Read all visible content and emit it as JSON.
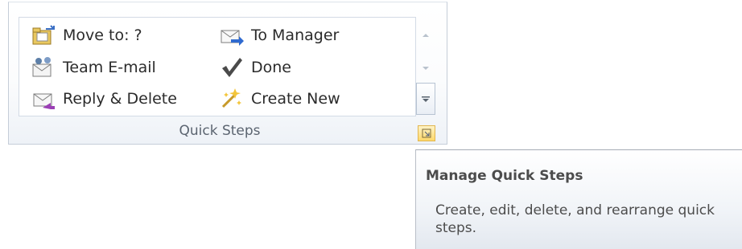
{
  "quick_steps": {
    "items": [
      {
        "label": "Move to: ?",
        "icon": "folder-move-icon"
      },
      {
        "label": "Team E-mail",
        "icon": "team-email-icon"
      },
      {
        "label": "Reply & Delete",
        "icon": "reply-delete-icon"
      },
      {
        "label": "To Manager",
        "icon": "forward-manager-icon"
      },
      {
        "label": "Done",
        "icon": "checkmark-icon"
      },
      {
        "label": "Create New",
        "icon": "create-new-icon"
      }
    ],
    "group_label": "Quick Steps",
    "scroll_icons": [
      "scroll-up-icon",
      "scroll-down-icon",
      "more-icon"
    ],
    "launcher_icon": "dialog-launcher-icon"
  },
  "tooltip": {
    "title": "Manage Quick Steps",
    "description": "Create, edit, delete, and rearrange quick steps."
  },
  "colors": {
    "group_border": "#c5cdd8",
    "launcher_highlight": "#ffd86a",
    "tooltip_text": "#4c4c4c",
    "label_text": "#5b6470"
  }
}
